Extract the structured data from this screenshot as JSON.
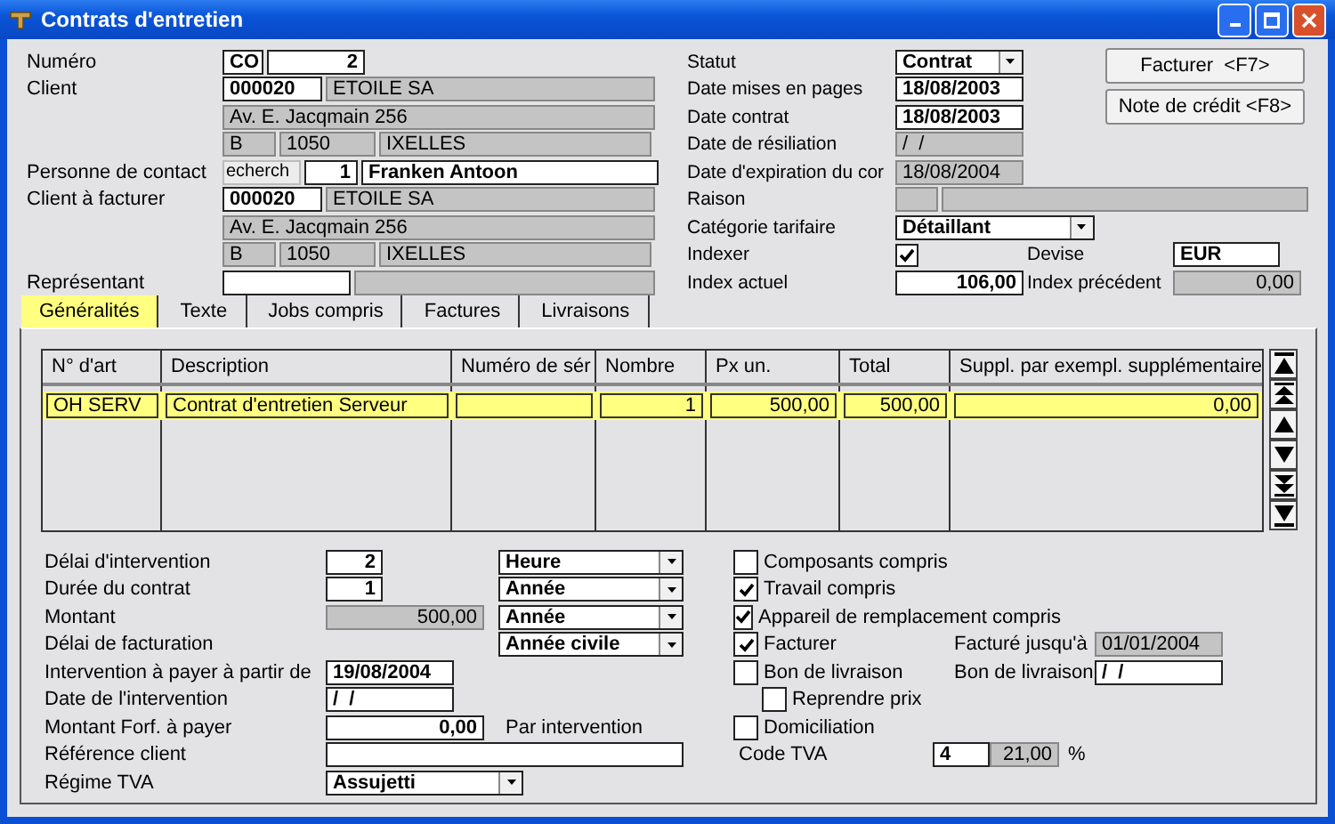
{
  "window": {
    "title": "Contrats d'entretien"
  },
  "left_rows": [
    {
      "label": "Numéro",
      "fields": [
        {
          "kind": "prefix",
          "value": "CO",
          "disabled": false
        },
        {
          "kind": "number",
          "value": "2",
          "disabled": false
        }
      ]
    },
    {
      "label": "Client",
      "fields": [
        {
          "kind": "code",
          "value": "000020",
          "disabled": false
        },
        {
          "kind": "name",
          "value": "ETOILE SA",
          "disabled": true
        }
      ]
    },
    {
      "fields": [
        {
          "kind": "address",
          "value": "Av. E. Jacqmain 256",
          "disabled": true
        }
      ]
    },
    {
      "fields": [
        {
          "kind": "country",
          "value": "B",
          "disabled": true
        },
        {
          "kind": "postcode",
          "value": "1050",
          "disabled": true
        },
        {
          "kind": "city",
          "value": "IXELLES",
          "disabled": true
        }
      ]
    },
    {
      "label": "Personne de contact",
      "fields": [
        {
          "kind": "search",
          "value": "echerch",
          "disabled": false
        },
        {
          "kind": "contact_no",
          "value": "1",
          "disabled": false
        },
        {
          "kind": "contact",
          "value": "Franken Antoon",
          "disabled": false
        }
      ]
    },
    {
      "label": "Client à facturer",
      "fields": [
        {
          "kind": "code",
          "value": "000020",
          "disabled": false
        },
        {
          "kind": "name",
          "value": "ETOILE SA",
          "disabled": true
        }
      ]
    },
    {
      "fields": [
        {
          "kind": "address",
          "value": "Av. E. Jacqmain 256",
          "disabled": true
        }
      ]
    },
    {
      "fields": [
        {
          "kind": "country",
          "value": "B",
          "disabled": true
        },
        {
          "kind": "postcode",
          "value": "1050",
          "disabled": true
        },
        {
          "kind": "city",
          "value": "IXELLES",
          "disabled": true
        }
      ]
    },
    {
      "label": "Représentant",
      "fields": [
        {
          "kind": "rep_code",
          "disabled": false
        },
        {
          "kind": "rep_name",
          "disabled": true
        }
      ]
    }
  ],
  "right_rows": [
    {
      "label": "Statut",
      "fields": [
        {
          "kind": "select",
          "value": "Contrat",
          "disabled": false
        }
      ]
    },
    {
      "label": "Date mises en pages",
      "fields": [
        {
          "kind": "date",
          "value": "18/08/2003",
          "disabled": false
        }
      ]
    },
    {
      "label": "Date contrat",
      "fields": [
        {
          "kind": "date",
          "value": "18/08/2003",
          "disabled": false
        }
      ]
    },
    {
      "label": "Date de résiliation",
      "fields": [
        {
          "kind": "date",
          "value": "/  /",
          "disabled": true
        }
      ]
    },
    {
      "label": "Date d'expiration du cor",
      "fields": [
        {
          "kind": "date",
          "value": "18/08/2004",
          "disabled": true
        }
      ]
    },
    {
      "label": "Raison",
      "fields": [
        {
          "kind": "raison_code",
          "disabled": true
        },
        {
          "kind": "raison",
          "disabled": true
        }
      ]
    },
    {
      "label": "Catégorie tarifaire",
      "fields": [
        {
          "kind": "select_wide",
          "value": "Détaillant",
          "disabled": false
        }
      ]
    },
    {
      "label": "Indexer",
      "fields": [
        {
          "kind": "checkbox",
          "checked": true,
          "disabled": false
        }
      ],
      "extra": {
        "label": "Devise",
        "fields": [
          {
            "kind": "currency",
            "value": "EUR",
            "disabled": false
          }
        ]
      }
    },
    {
      "label": "Index actuel",
      "fields": [
        {
          "kind": "amount",
          "value": "106,00",
          "disabled": false
        }
      ],
      "extra": {
        "label": "Index précédent",
        "fields": [
          {
            "kind": "amount",
            "value": "0,00",
            "disabled": true
          }
        ]
      }
    }
  ],
  "buttons": [
    "Facturer  <F7>",
    "Note de crédit <F8>"
  ],
  "tabs": [
    {
      "label": "Généralités",
      "selected": true
    },
    {
      "label": "Texte",
      "selected": false
    },
    {
      "label": "Jobs compris",
      "selected": false
    },
    {
      "label": "Factures",
      "selected": false
    },
    {
      "label": "Livraisons",
      "selected": false
    }
  ],
  "table": {
    "columns": [
      {
        "label": "N° d'art",
        "kind": "text"
      },
      {
        "label": "Description",
        "kind": "text"
      },
      {
        "label": "Numéro de sér",
        "kind": "text"
      },
      {
        "label": "Nombre",
        "kind": "number"
      },
      {
        "label": "Px un.",
        "kind": "number"
      },
      {
        "label": "Total",
        "kind": "number"
      },
      {
        "label": "Suppl. par exempl. supplémentaire",
        "kind": "number"
      }
    ],
    "rows": [
      {
        "selected": true,
        "cells": [
          "OH SERV",
          "Contrat d'entretien Serveur",
          "",
          "1",
          "500,00",
          "500,00",
          "0,00"
        ]
      }
    ]
  },
  "details": [
    {
      "label": "Délai d'intervention",
      "kind": "number_unit",
      "value": "2",
      "disabled": false,
      "unit": "Heure"
    },
    {
      "label": "Durée du contrat",
      "kind": "number_unit",
      "value": "1",
      "disabled": false,
      "unit": "Année"
    },
    {
      "label": "Montant",
      "kind": "amount_unit",
      "value": "500,00",
      "disabled": true,
      "unit": "Année"
    },
    {
      "label": "Délai de facturation",
      "kind": "unit",
      "unit": "Année civile"
    },
    {
      "label": "Intervention à payer à partir de",
      "kind": "date",
      "value": "19/08/2004",
      "disabled": false
    },
    {
      "label": "Date de l'intervention",
      "kind": "date",
      "value": "/  /",
      "disabled": false
    },
    {
      "label": "Montant Forf. à payer",
      "kind": "amount",
      "value": "0,00",
      "disabled": false,
      "note": "Par intervention"
    },
    {
      "label": "Référence client",
      "kind": "text",
      "disabled": false
    },
    {
      "label": "Régime TVA",
      "kind": "select",
      "value": "Assujetti"
    }
  ],
  "options": [
    {
      "label": "Composants compris",
      "checked": false
    },
    {
      "label": "Travail compris",
      "checked": true
    },
    {
      "label": "Appareil de remplacement compris",
      "checked": true
    },
    {
      "label": "Facturer",
      "checked": true,
      "side": {
        "label": "Facturé jusqu'à",
        "value": "01/01/2004",
        "disabled": true
      }
    },
    {
      "label": "Bon de livraison",
      "checked": false,
      "side": {
        "label": "Bon de livraison",
        "value": "/  /",
        "disabled": false
      },
      "children": [
        {
          "label": "Reprendre prix",
          "checked": false
        }
      ]
    },
    {
      "label": "Domiciliation",
      "checked": false
    }
  ],
  "vat": {
    "label": "Code TVA",
    "code": "4",
    "rate": "21,00",
    "unit": "%"
  }
}
